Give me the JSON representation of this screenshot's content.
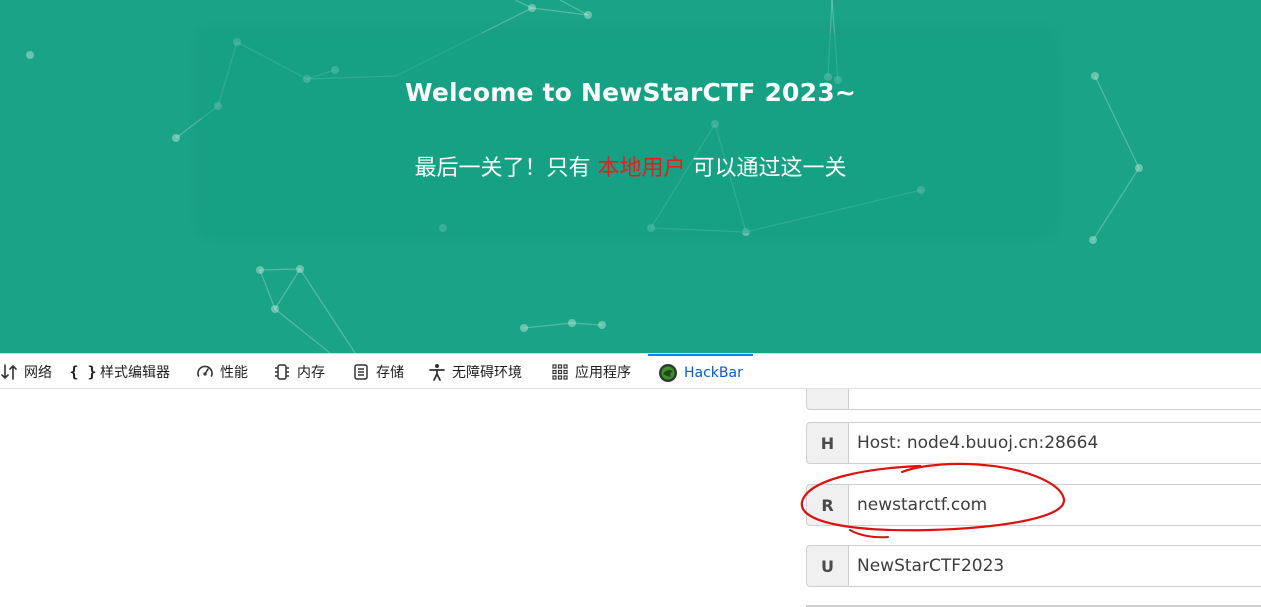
{
  "page": {
    "title": "Welcome to NewStarCTF 2023~",
    "subtitle_before": "最后一关了！只有",
    "subtitle_highlight": "本地用户",
    "subtitle_after": "可以通过这一关",
    "bg_color": "#1aa387",
    "highlight_color": "#e81c1c"
  },
  "devtools": {
    "tabs": [
      {
        "label": "网络",
        "icon": "network-arrows-icon"
      },
      {
        "label": "样式编辑器",
        "icon": "braces-icon"
      },
      {
        "label": "性能",
        "icon": "gauge-icon"
      },
      {
        "label": "内存",
        "icon": "memory-chip-icon"
      },
      {
        "label": "存储",
        "icon": "storage-icon"
      },
      {
        "label": "无障碍环境",
        "icon": "accessibility-icon"
      },
      {
        "label": "应用程序",
        "icon": "grid-apps-icon"
      },
      {
        "label": "HackBar",
        "icon": "hackbar-logo-icon"
      }
    ],
    "active_tab": "HackBar",
    "active_color": "#0a84ff"
  },
  "hackbar": {
    "headers": [
      {
        "key": "H",
        "value": "Host: node4.buuoj.cn:28664"
      },
      {
        "key": "R",
        "value": "newstarctf.com"
      },
      {
        "key": "U",
        "value": "NewStarCTF2023"
      }
    ]
  }
}
